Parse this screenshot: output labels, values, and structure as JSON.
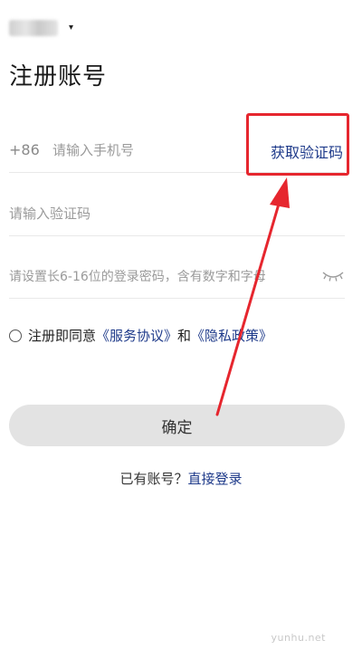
{
  "header": {
    "region_caret": "▾",
    "title": "注册账号"
  },
  "form": {
    "phone": {
      "country_code": "+86",
      "placeholder": "请输入手机号",
      "get_code_label": "获取验证码"
    },
    "code": {
      "placeholder": "请输入验证码"
    },
    "password": {
      "placeholder": "请设置长6-16位的登录密码，含有数字和字母",
      "visibility_icon": "eye-closed-icon"
    },
    "agreement": {
      "prefix": "注册即同意",
      "service_link": "《服务协议》",
      "conjunction": "和",
      "privacy_link": "《隐私政策》"
    },
    "confirm_label": "确定"
  },
  "footer": {
    "have_account": "已有账号？",
    "login_link": "直接登录"
  },
  "watermark": "yunhu.net",
  "colors": {
    "link": "#1e3a8a",
    "annotation": "#e6262e",
    "button_bg": "#e3e3e3"
  }
}
